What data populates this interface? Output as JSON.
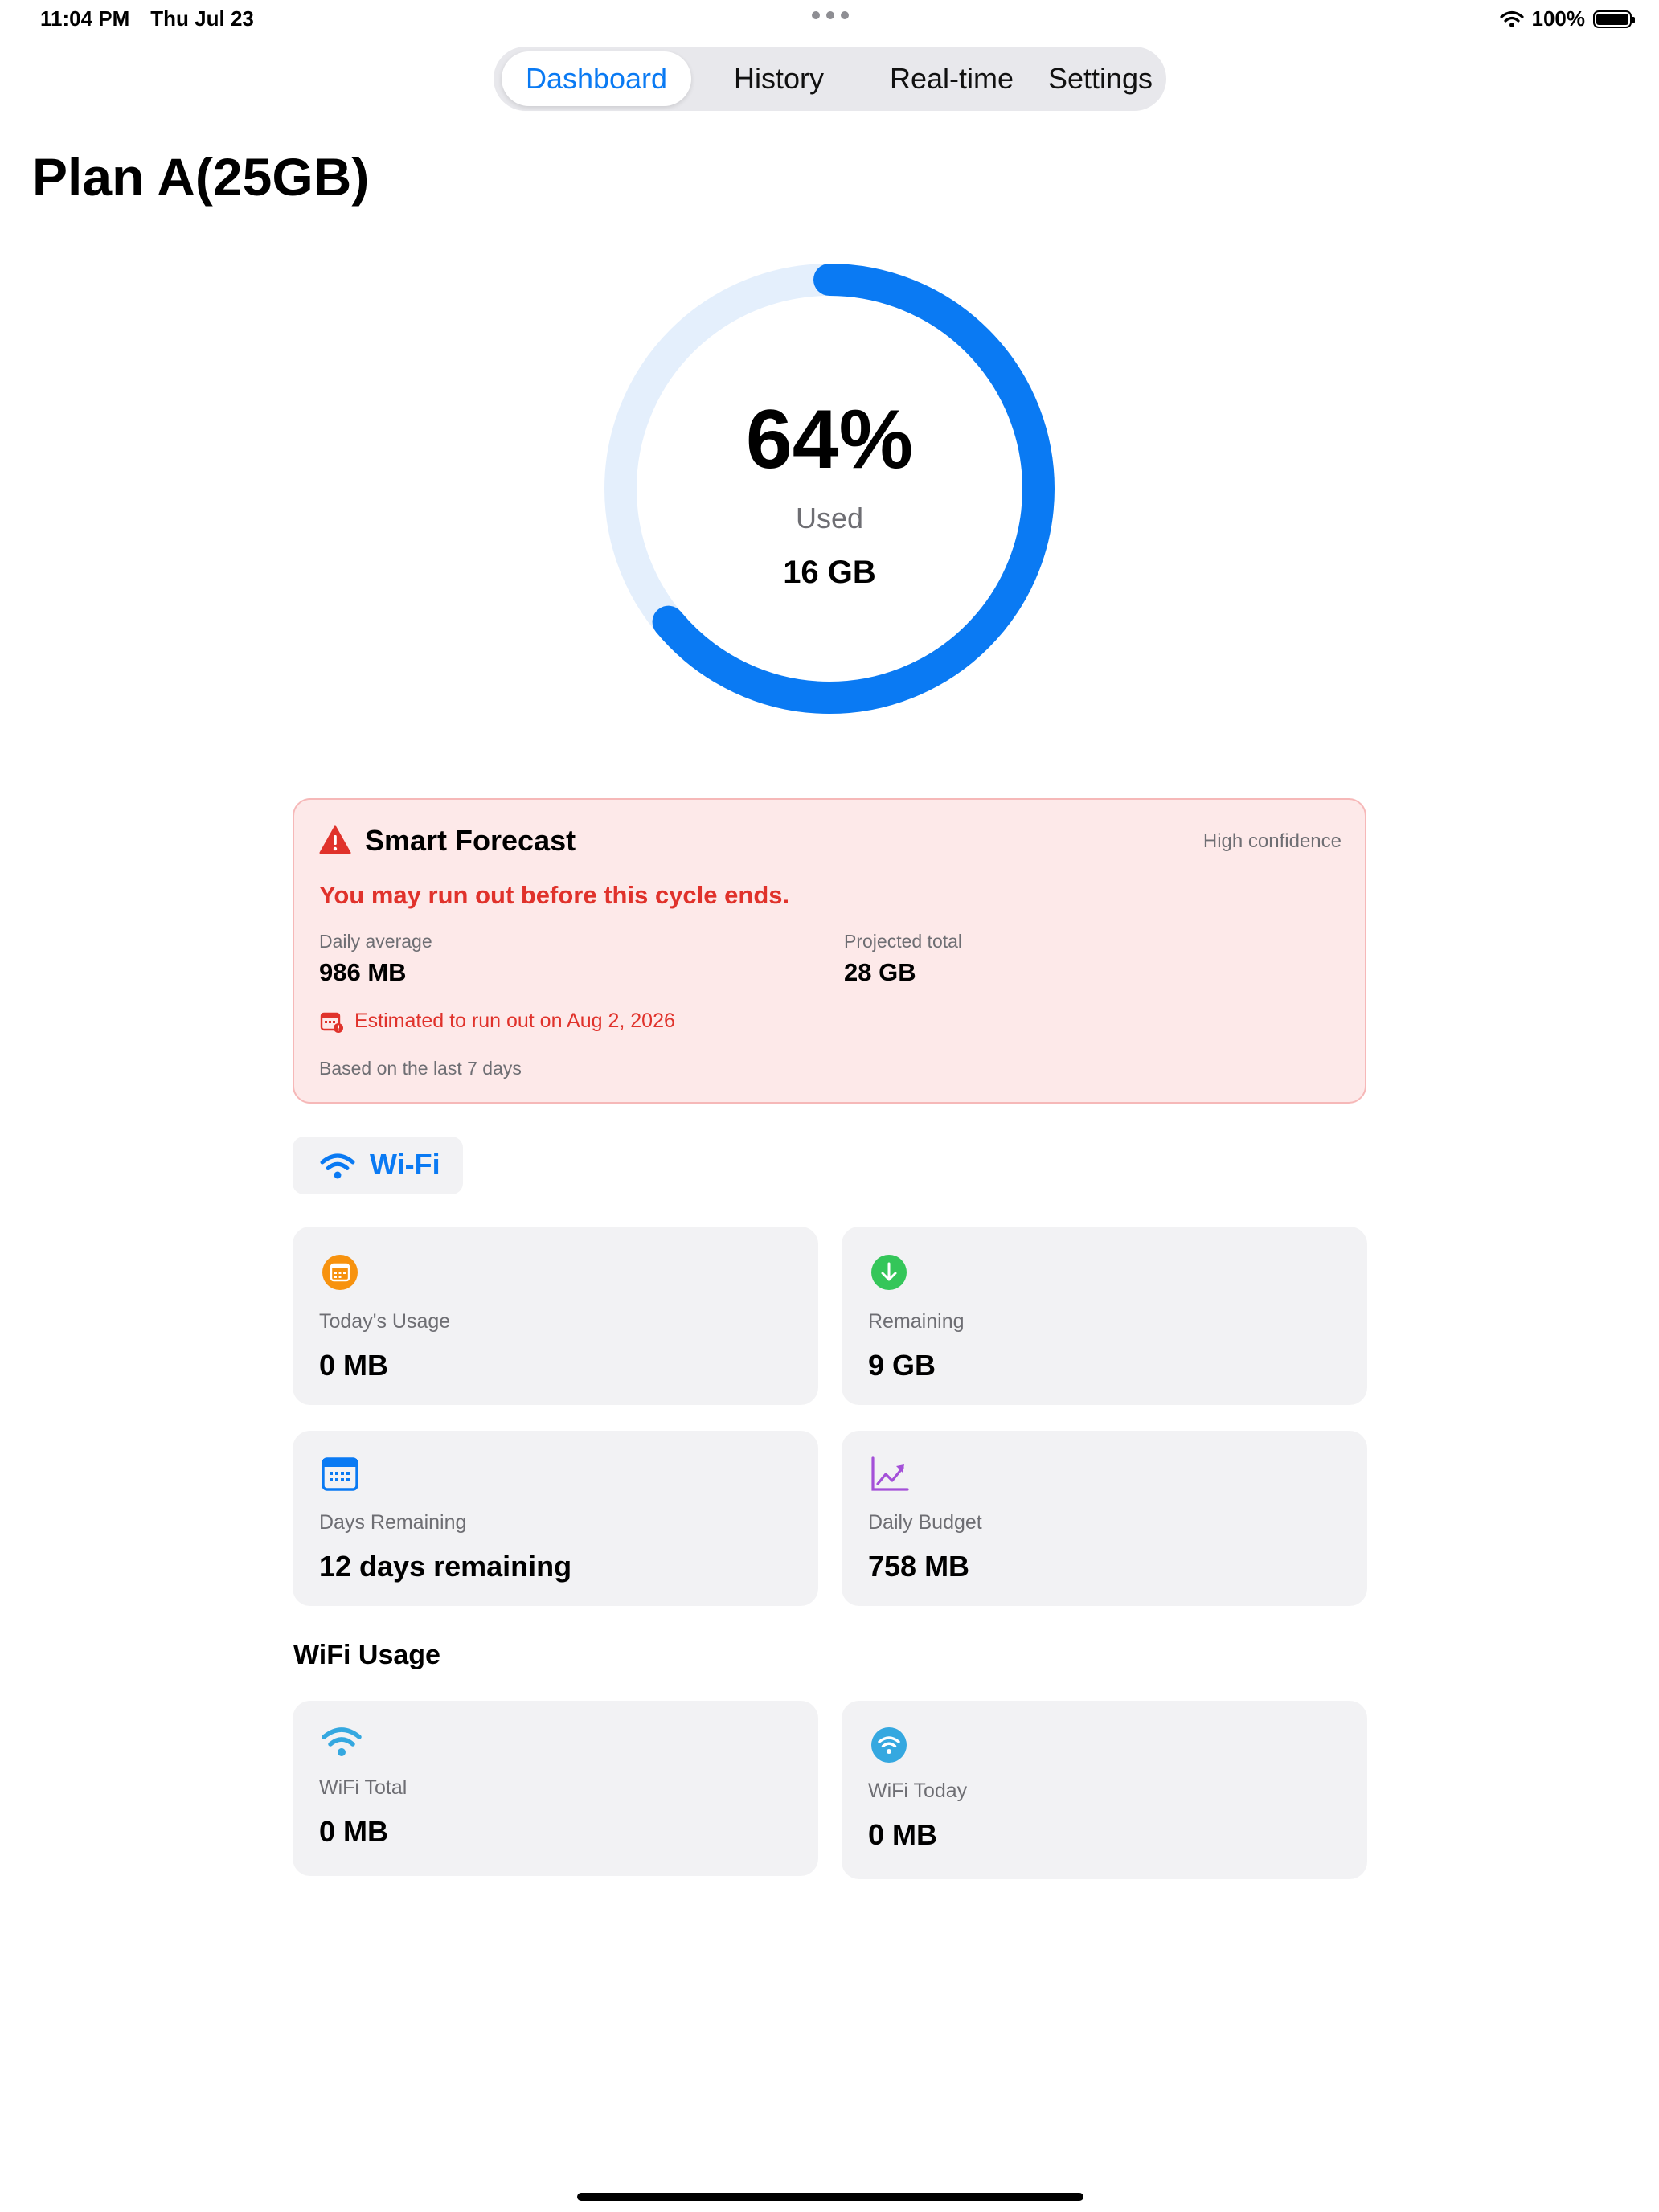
{
  "status_bar": {
    "time": "11:04 PM",
    "date": "Thu Jul 23",
    "battery": "100%"
  },
  "tabs": [
    {
      "label": "Dashboard",
      "active": true
    },
    {
      "label": "History",
      "active": false
    },
    {
      "label": "Real-time",
      "active": false
    },
    {
      "label": "Settings",
      "active": false
    }
  ],
  "plan": {
    "title": "Plan A(25GB)"
  },
  "usage_ring": {
    "percent_label": "64%",
    "used_label": "Used",
    "amount": "16 GB",
    "fraction_used": 0.64,
    "colors": {
      "progress": "#0a7af3",
      "track": "#e4effc"
    }
  },
  "forecast": {
    "title": "Smart Forecast",
    "confidence": "High confidence",
    "warning": "You may run out before this cycle ends.",
    "daily_average_label": "Daily average",
    "daily_average": "986 MB",
    "projected_total_label": "Projected total",
    "projected_total": "28 GB",
    "estimate": "Estimated to run out on Aug 2, 2026",
    "basis": "Based on the last 7 days",
    "colors": {
      "background": "#fde9e9",
      "accent": "#e0322b"
    }
  },
  "network_chip": {
    "label": "Wi-Fi",
    "icon": "wifi-icon"
  },
  "stats": {
    "today_label": "Today's Usage",
    "today": "0 MB",
    "remaining_label": "Remaining",
    "remaining": "9 GB",
    "days_label": "Days Remaining",
    "days": "12 days remaining",
    "budget_label": "Daily Budget",
    "budget": "758 MB"
  },
  "wifi_usage": {
    "section_title": "WiFi Usage",
    "total_label": "WiFi Total",
    "total": "0 MB",
    "today_label": "WiFi Today",
    "today": "0 MB"
  }
}
